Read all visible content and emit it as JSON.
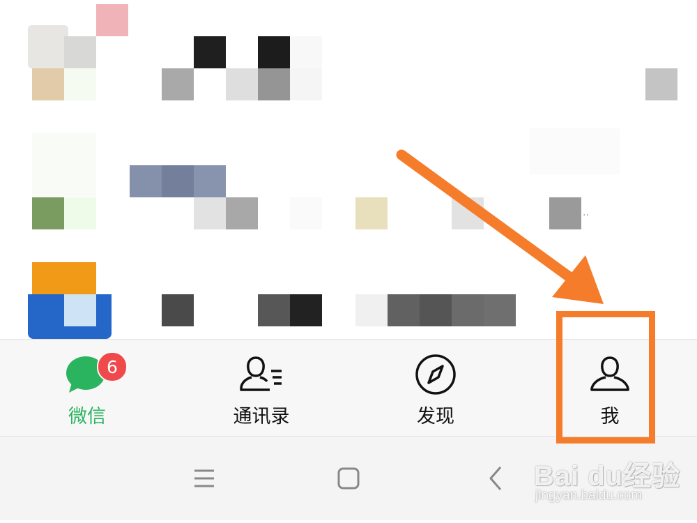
{
  "tabs": [
    {
      "id": "chats",
      "label": "微信",
      "icon": "chat-bubble-icon",
      "active": true,
      "badge": "6"
    },
    {
      "id": "contacts",
      "label": "通讯录",
      "icon": "contacts-icon",
      "active": false
    },
    {
      "id": "discover",
      "label": "发现",
      "icon": "compass-icon",
      "active": false
    },
    {
      "id": "me",
      "label": "我",
      "icon": "person-icon",
      "active": false
    }
  ],
  "system_nav": [
    {
      "id": "menu",
      "icon": "menu-icon"
    },
    {
      "id": "home",
      "icon": "home-square-icon"
    },
    {
      "id": "back",
      "icon": "back-chevron-icon"
    }
  ],
  "annotation": {
    "color": "#f57c2a",
    "target": "我"
  },
  "colors": {
    "accent_green": "#2bb45f",
    "badge_red": "#f0494b",
    "tabbar_bg": "#f7f7f7"
  },
  "watermark": {
    "brand": "Bai du经验",
    "url": "jingyan.baidu.com"
  }
}
